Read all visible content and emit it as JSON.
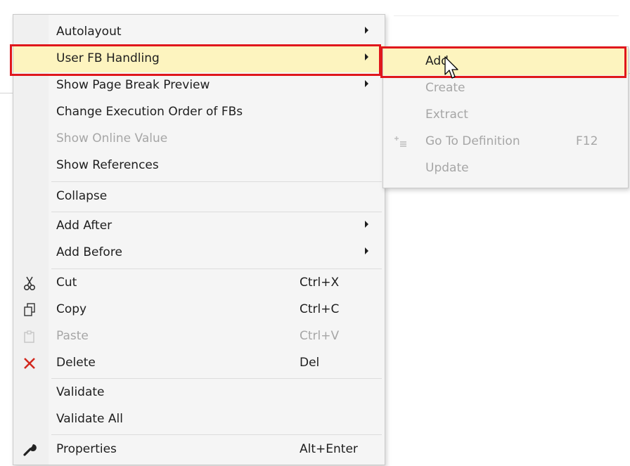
{
  "menu": {
    "items": [
      {
        "label": "Autolayout",
        "submenu": true
      },
      {
        "label": "User FB Handling",
        "submenu": true,
        "highlighted": true
      },
      {
        "label": "Show Page Break Preview",
        "submenu": true
      },
      {
        "label": "Change Execution Order of FBs"
      },
      {
        "label": "Show Online Value",
        "disabled": true
      },
      {
        "label": "Show References"
      },
      {
        "label": "Collapse"
      },
      {
        "label": "Add After",
        "submenu": true
      },
      {
        "label": "Add Before",
        "submenu": true
      },
      {
        "label": "Cut",
        "shortcut": "Ctrl+X",
        "icon": "scissors-icon"
      },
      {
        "label": "Copy",
        "shortcut": "Ctrl+C",
        "icon": "copy-icon"
      },
      {
        "label": "Paste",
        "shortcut": "Ctrl+V",
        "icon": "paste-icon",
        "disabled": true
      },
      {
        "label": "Delete",
        "shortcut": "Del",
        "icon": "delete-x-icon"
      },
      {
        "label": "Validate"
      },
      {
        "label": "Validate All"
      },
      {
        "label": "Properties",
        "shortcut": "Alt+Enter",
        "icon": "wrench-icon"
      }
    ]
  },
  "submenu": {
    "items": [
      {
        "label": "Add",
        "highlighted": true
      },
      {
        "label": "Create",
        "disabled": true
      },
      {
        "label": "Extract",
        "disabled": true
      },
      {
        "label": "Go To Definition",
        "shortcut": "F12",
        "icon": "go-to-definition-icon",
        "disabled": true
      },
      {
        "label": "Update",
        "disabled": true
      }
    ]
  },
  "colors": {
    "highlight": "#fdf4bf",
    "annotation_red": "#e0171c",
    "disabled_text": "#a6a6a6",
    "delete_icon": "#d2281e"
  }
}
